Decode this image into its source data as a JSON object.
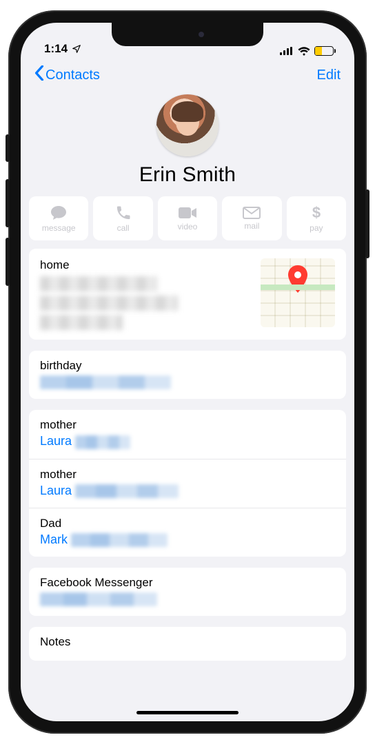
{
  "status": {
    "time": "1:14"
  },
  "nav": {
    "back_label": "Contacts",
    "edit_label": "Edit"
  },
  "contact": {
    "name": "Erin Smith"
  },
  "actions": [
    {
      "key": "message",
      "label": "message"
    },
    {
      "key": "call",
      "label": "call"
    },
    {
      "key": "video",
      "label": "video"
    },
    {
      "key": "mail",
      "label": "mail"
    },
    {
      "key": "pay",
      "label": "pay"
    }
  ],
  "sections": {
    "home_label": "home",
    "birthday_label": "birthday",
    "relations": [
      {
        "label": "mother",
        "name": "Laura"
      },
      {
        "label": "mother",
        "name": "Laura"
      },
      {
        "label": "Dad",
        "name": "Mark"
      }
    ],
    "messenger_label": "Facebook Messenger",
    "notes_label": "Notes"
  }
}
